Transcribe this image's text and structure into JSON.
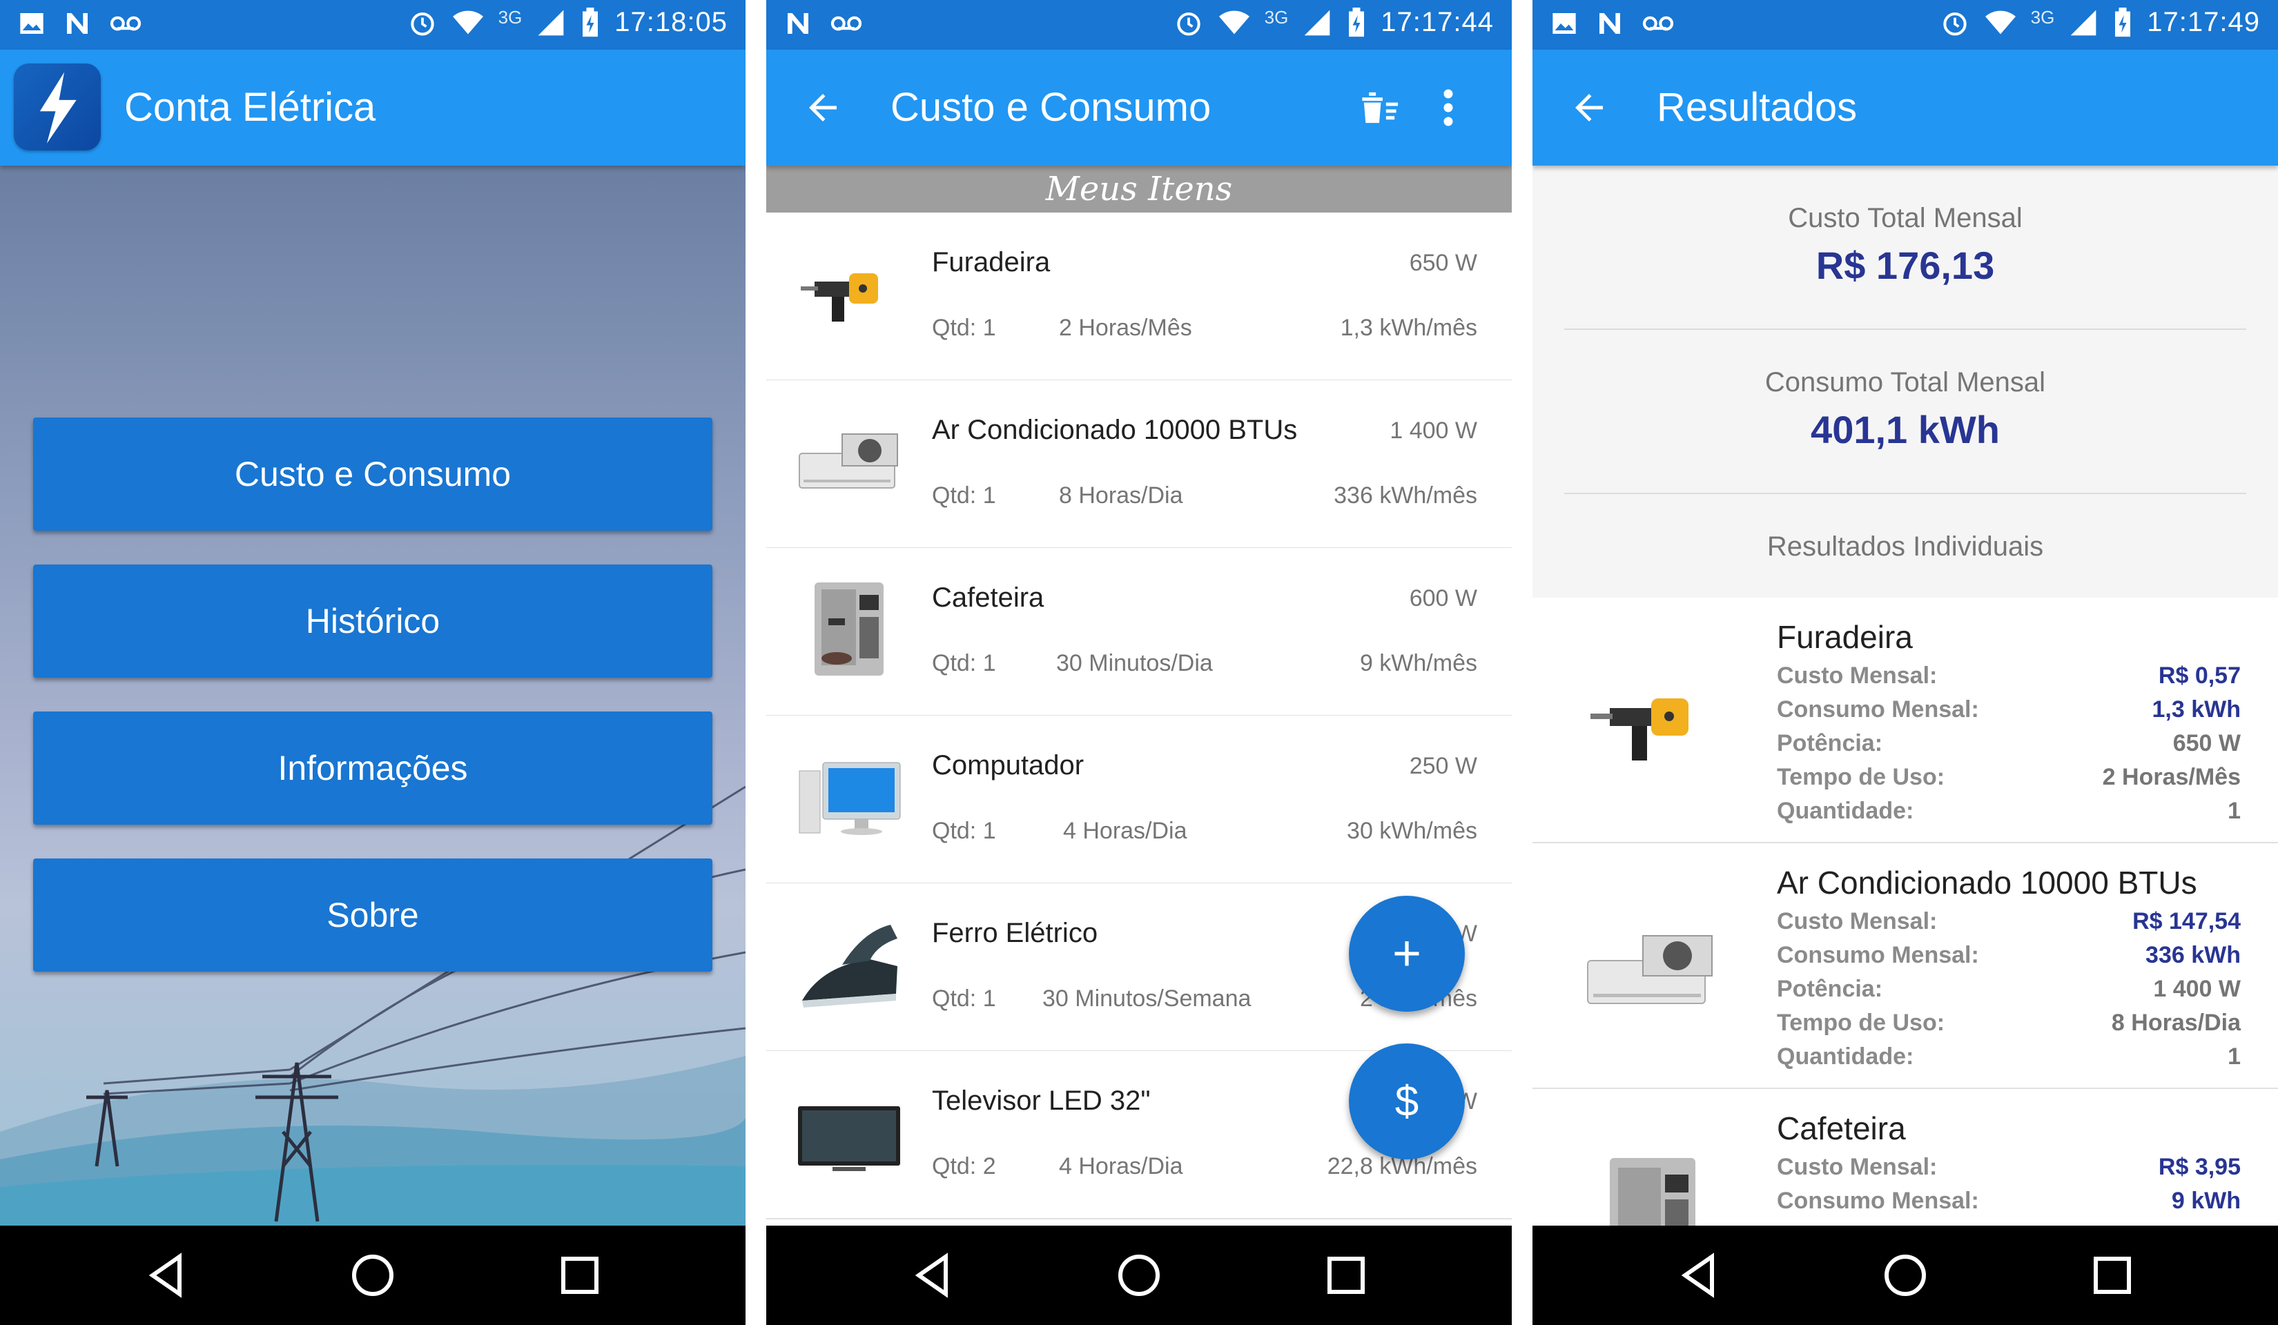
{
  "colors": {
    "primary_dark": "#1976d2",
    "primary": "#2196f3",
    "accent_text": "#283593",
    "navbar": "#000000"
  },
  "phones": [
    {
      "status": {
        "time": "17:18:05",
        "network": "3G"
      }
    },
    {
      "status": {
        "time": "17:17:44",
        "network": "3G"
      }
    },
    {
      "status": {
        "time": "17:17:49",
        "network": "3G"
      }
    }
  ],
  "home": {
    "title": "Conta Elétrica",
    "menu": [
      {
        "label": "Custo e Consumo"
      },
      {
        "label": "Histórico"
      },
      {
        "label": "Informações"
      },
      {
        "label": "Sobre"
      }
    ]
  },
  "custo": {
    "title": "Custo e Consumo",
    "section": "Meus Itens",
    "items": [
      {
        "name": "Furadeira",
        "power": "650  W",
        "qtd": "Qtd: 1",
        "time": "2 Horas/Mês",
        "kwh": "1,3 kWh/mês",
        "icon": "drill-icon"
      },
      {
        "name": "Ar Condicionado 10000 BTUs",
        "power": "1 400  W",
        "qtd": "Qtd: 1",
        "time": "8 Horas/Dia",
        "kwh": "336 kWh/mês",
        "icon": "air-conditioner-icon"
      },
      {
        "name": "Cafeteira",
        "power": "600  W",
        "qtd": "Qtd: 1",
        "time": "30 Minutos/Dia",
        "kwh": "9 kWh/mês",
        "icon": "coffee-maker-icon"
      },
      {
        "name": "Computador",
        "power": "250  W",
        "qtd": "Qtd: 1",
        "time": "4 Horas/Dia",
        "kwh": "30 kWh/mês",
        "icon": "computer-icon"
      },
      {
        "name": "Ferro Elétrico",
        "power": "W",
        "qtd": "Qtd: 1",
        "time": "30 Minutos/Semana",
        "kwh": "2 kWh/mês",
        "icon": "iron-icon"
      },
      {
        "name": "Televisor LED 32\"",
        "power": "W",
        "qtd": "Qtd: 2",
        "time": "4 Horas/Dia",
        "kwh": "22,8 kWh/mês",
        "icon": "tv-icon"
      }
    ],
    "fab_add": "+",
    "fab_cost": "$"
  },
  "results": {
    "title": "Resultados",
    "total_cost_label": "Custo Total Mensal",
    "total_cost": "R$ 176,13",
    "total_consumption_label": "Consumo Total Mensal",
    "total_consumption": "401,1 kWh",
    "individual_label": "Resultados Individuais",
    "row_labels": {
      "cost": "Custo Mensal:",
      "consumption": "Consumo Mensal:",
      "power": "Potência:",
      "time": "Tempo de Uso:",
      "qty": "Quantidade:"
    },
    "cards": [
      {
        "name": "Furadeira",
        "cost": "R$ 0,57",
        "consumption": "1,3 kWh",
        "power": "650 W",
        "time": "2  Horas/Mês",
        "qty": "1"
      },
      {
        "name": "Ar Condicionado 10000 BTUs",
        "cost": "R$ 147,54",
        "consumption": "336 kWh",
        "power": "1 400 W",
        "time": "8  Horas/Dia",
        "qty": "1"
      },
      {
        "name": "Cafeteira",
        "cost": "R$ 3,95",
        "consumption": "9 kWh",
        "power": "",
        "time": "",
        "qty": ""
      }
    ]
  }
}
